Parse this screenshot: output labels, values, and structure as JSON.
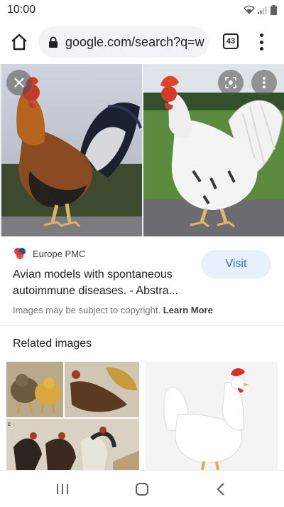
{
  "status_bar": {
    "time": "10:00"
  },
  "toolbar": {
    "url": "google.com/search?q=w",
    "tab_count": "43"
  },
  "result": {
    "source_name": "Europe PMC",
    "title": "Avian models with spontaneous autoimmune diseases. - Abstra...",
    "visit_label": "Visit",
    "copyright_text": "Images may be subject to copyright.",
    "learn_more_label": "Learn More"
  },
  "related": {
    "heading": "Related images"
  },
  "icons": {
    "home": "home-icon",
    "lock": "lock-icon",
    "menu": "more-vert-icon",
    "close": "close-icon",
    "lens": "google-lens-icon",
    "more": "more-vert-icon",
    "recents": "recents-icon",
    "nav_home": "nav-home-icon",
    "back": "back-icon"
  },
  "colors": {
    "accent": "#1a73e8",
    "visit_bg": "#e8f0fe",
    "url_pill_bg": "#f1f3f4"
  }
}
